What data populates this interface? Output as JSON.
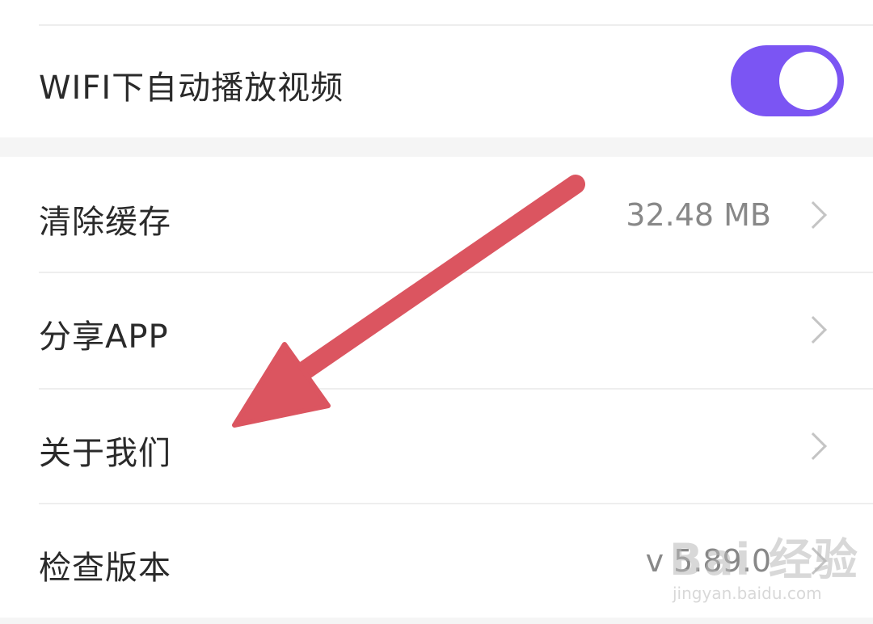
{
  "settings": {
    "wifi_autoplay": {
      "label": "WIFI下自动播放视频",
      "enabled": true
    },
    "clear_cache": {
      "label": "清除缓存",
      "value": "32.48 MB"
    },
    "share_app": {
      "label": "分享APP"
    },
    "about_us": {
      "label": "关于我们"
    },
    "check_version": {
      "label": "检查版本",
      "value": "v 5.89.0"
    }
  },
  "colors": {
    "toggle_on": "#7b55f3",
    "annotation_arrow": "#db5560",
    "background": "#f5f5f5"
  },
  "watermark": {
    "logo_text": "Bai 经验",
    "url": "jingyan.baidu.com"
  }
}
